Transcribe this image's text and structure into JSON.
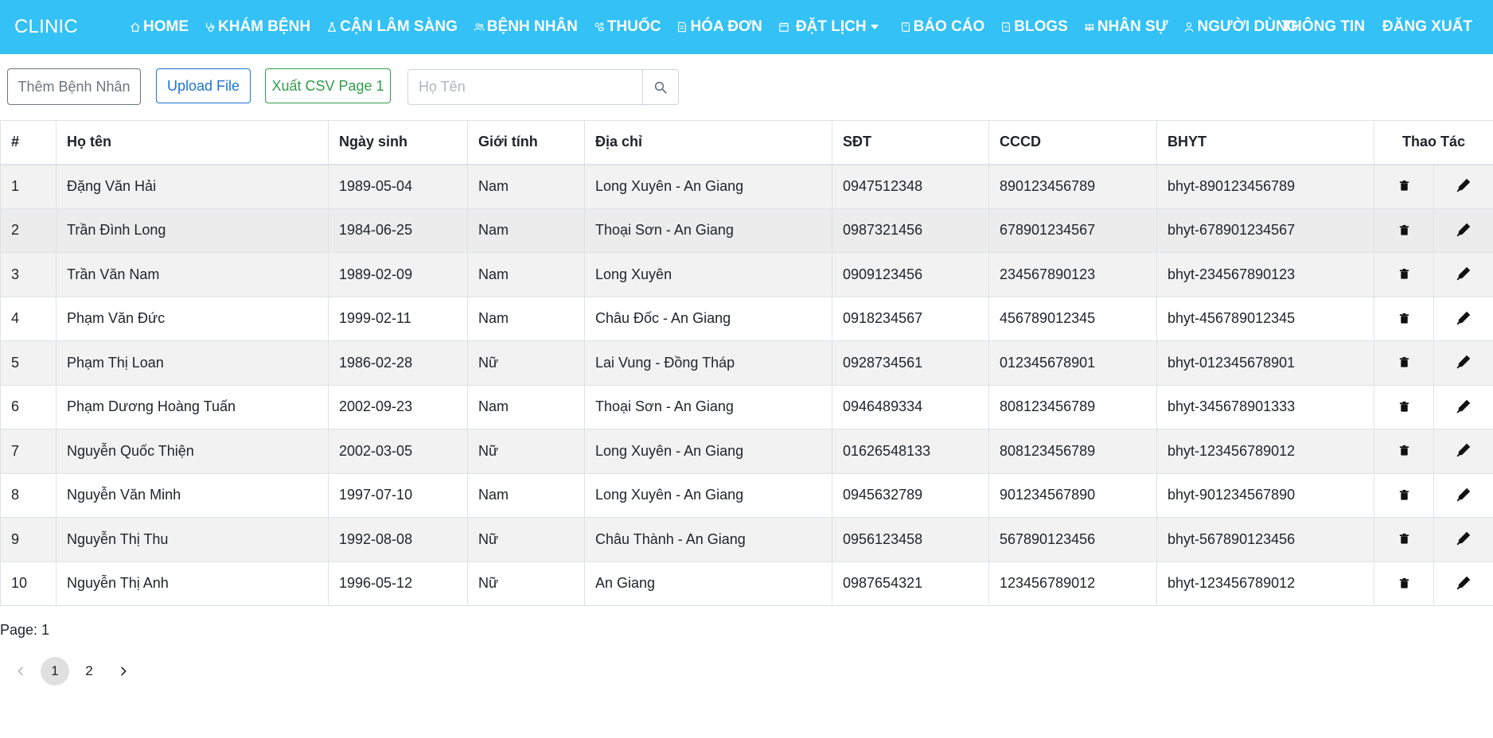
{
  "app": {
    "brand": "CLINIC"
  },
  "nav": {
    "items": [
      {
        "label": "HOME",
        "icon": "home-icon"
      },
      {
        "label": "KHÁM BỆNH",
        "icon": "stethoscope-icon"
      },
      {
        "label": "CẬN LÂM SÀNG",
        "icon": "flask-icon"
      },
      {
        "label": "BỆNH NHÂN",
        "icon": "users-icon"
      },
      {
        "label": "THUỐC",
        "icon": "pills-icon"
      },
      {
        "label": "HÓA ĐƠN",
        "icon": "invoice-icon"
      },
      {
        "label": "ĐẶT LỊCH",
        "icon": "calendar-icon",
        "dropdown": true
      },
      {
        "label": "BÁO CÁO",
        "icon": "report-icon"
      },
      {
        "label": "BLOGS",
        "icon": "blog-icon"
      },
      {
        "label": "NHÂN SỰ",
        "icon": "staff-icon"
      },
      {
        "label": "NGƯỜI DÙNG",
        "icon": "user-icon"
      }
    ],
    "right": {
      "info": "THÔNG TIN",
      "logout": "ĐĂNG XUẤT"
    }
  },
  "toolbar": {
    "add_patient": "Thêm Bệnh Nhân",
    "upload_file": "Upload File",
    "export_csv": "Xuất CSV Page 1",
    "search_placeholder": "Họ Tên",
    "search_icon": "search-icon"
  },
  "table": {
    "headers": [
      "#",
      "Họ tên",
      "Ngày sinh",
      "Giới tính",
      "Địa chỉ",
      "SĐT",
      "CCCD",
      "BHYT",
      "Thao Tác"
    ],
    "action_icons": {
      "delete": "trash-icon",
      "edit": "edit-icon"
    },
    "rows": [
      [
        "1",
        "Đặng Văn Hải",
        "1989-05-04",
        "Nam",
        "Long Xuyên - An Giang",
        "0947512348",
        "890123456789",
        "bhyt-890123456789"
      ],
      [
        "2",
        "Trần Đình Long",
        "1984-06-25",
        "Nam",
        "Thoại Sơn - An Giang",
        "0987321456",
        "678901234567",
        "bhyt-678901234567"
      ],
      [
        "3",
        "Trần Văn Nam",
        "1989-02-09",
        "Nam",
        "Long Xuyên",
        "0909123456",
        "234567890123",
        "bhyt-234567890123"
      ],
      [
        "4",
        "Phạm Văn Đức",
        "1999-02-11",
        "Nam",
        "Châu Đốc - An Giang",
        "0918234567",
        "456789012345",
        "bhyt-456789012345"
      ],
      [
        "5",
        "Phạm Thị Loan",
        "1986-02-28",
        "Nữ",
        "Lai Vung - Đồng Tháp",
        "0928734561",
        "012345678901",
        "bhyt-012345678901"
      ],
      [
        "6",
        "Phạm Dương Hoàng Tuấn",
        "2002-09-23",
        "Nam",
        "Thoại Sơn - An Giang",
        "0946489334",
        "808123456789",
        "bhyt-345678901333"
      ],
      [
        "7",
        "Nguyễn Quốc Thiện",
        "2002-03-05",
        "Nữ",
        "Long Xuyên - An Giang",
        "01626548133",
        "808123456789",
        "bhyt-123456789012"
      ],
      [
        "8",
        "Nguyễn Văn Minh",
        "1997-07-10",
        "Nam",
        "Long Xuyên - An Giang",
        "0945632789",
        "901234567890",
        "bhyt-901234567890"
      ],
      [
        "9",
        "Nguyễn Thị Thu",
        "1992-08-08",
        "Nữ",
        "Châu Thành - An Giang",
        "0956123458",
        "567890123456",
        "bhyt-567890123456"
      ],
      [
        "10",
        "Nguyễn Thị Anh",
        "1996-05-12",
        "Nữ",
        "An Giang",
        "0987654321",
        "123456789012",
        "bhyt-123456789012"
      ]
    ]
  },
  "pagination": {
    "label": "Page: 1",
    "pages": [
      "1",
      "2"
    ],
    "current": "1",
    "prev_icon": "chevron-left-icon",
    "next_icon": "chevron-right-icon"
  },
  "colors": {
    "navbar": "#33c1f6",
    "upload": "#1976d2",
    "export": "#2e9d4c",
    "add": "#6c757d"
  }
}
